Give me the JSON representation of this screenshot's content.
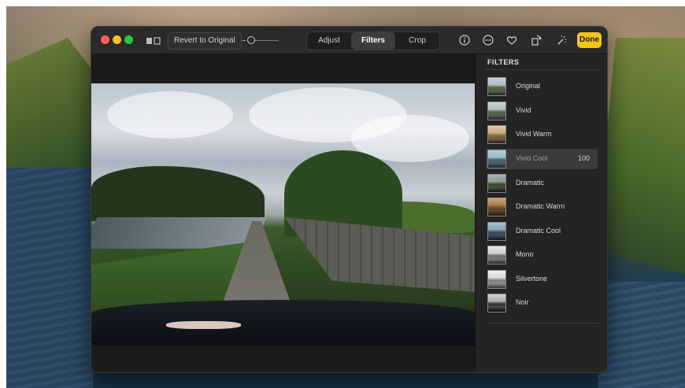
{
  "toolbar": {
    "revert_label": "Revert to Original",
    "tabs": [
      {
        "label": "Adjust",
        "active": false
      },
      {
        "label": "Filters",
        "active": true
      },
      {
        "label": "Crop",
        "active": false
      }
    ],
    "icons": [
      "info-icon",
      "more-icon",
      "heart-icon",
      "rotate-icon",
      "magic-wand-icon"
    ],
    "done_label": "Done",
    "accent_color": "#f5c518"
  },
  "panel": {
    "title": "FILTERS",
    "filters": [
      {
        "name": "Original"
      },
      {
        "name": "Vivid"
      },
      {
        "name": "Vivid Warm"
      },
      {
        "name": "Vivid Cool",
        "value": "100",
        "selected": true
      },
      {
        "name": "Dramatic"
      },
      {
        "name": "Dramatic Warm"
      },
      {
        "name": "Dramatic Cool"
      },
      {
        "name": "Mono"
      },
      {
        "name": "Silvertone"
      },
      {
        "name": "Noir"
      }
    ]
  }
}
